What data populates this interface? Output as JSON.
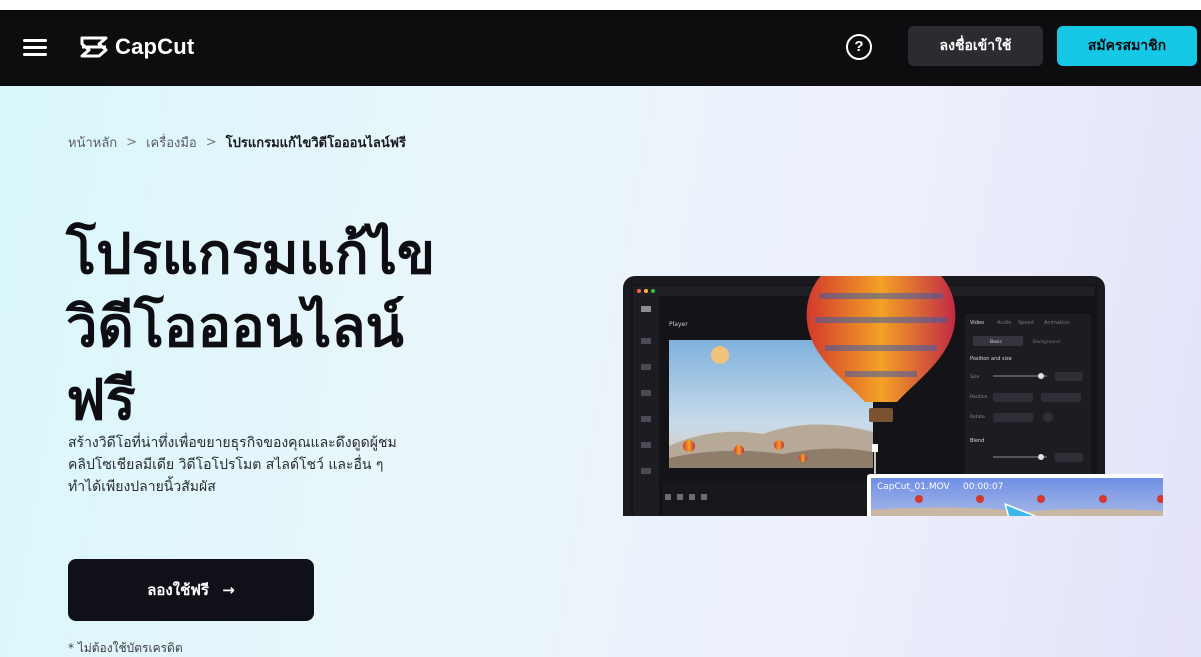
{
  "browser": {
    "url_label": "",
    "url_text": ""
  },
  "navbar": {
    "brand": "CapCut",
    "help_symbol": "?",
    "login_label": "ลงชื่อเข้าใช้",
    "signup_label": "สมัครสมาชิก"
  },
  "breadcrumb": {
    "items": [
      "หน้าหลัก",
      "เครื่องมือ",
      "โปรแกรมแก้ไขวิดีโอออนไลน์ฟรี"
    ],
    "separator": ">"
  },
  "hero": {
    "title_lines": [
      "โปรแกรมแก้ไข",
      "วิดีโอออนไลน์",
      "ฟรี"
    ],
    "description_lines": [
      "สร้างวิดีโอที่น่าทึ่งเพื่อขยายธุรกิจของคุณและดึงดูดผู้ชม",
      "คลิปโซเชียลมีเดีย วิดีโอโปรโมต สไลด์โชว์ และอื่น ๆ",
      "ทำได้เพียงปลายนิ้วสัมผัส"
    ],
    "cta_label": "ลองใช้ฟรี",
    "cta_arrow": "→",
    "note": "* ไม่ต้องใช้บัตรเครดิต"
  },
  "editor": {
    "player_label": "Player",
    "tabs": [
      "Video",
      "Audio",
      "Speed",
      "Animation"
    ],
    "subtabs": [
      "Basic",
      "Background"
    ],
    "position_title": "Position and size",
    "size_label": "Size",
    "position_label": "Position",
    "rotate_label": "Rotate",
    "blend_title": "Blend",
    "clip_name": "CapCut_01.MOV",
    "clip_time": "00:00:07"
  },
  "colors": {
    "accent": "#14c8e6",
    "navbar_bg": "#0d0d10",
    "cta_bg": "#101018"
  },
  "icons": [
    "menu-icon",
    "capcut-logo-icon",
    "help-icon",
    "arrow-right-icon",
    "cursor-arrow-icon"
  ]
}
